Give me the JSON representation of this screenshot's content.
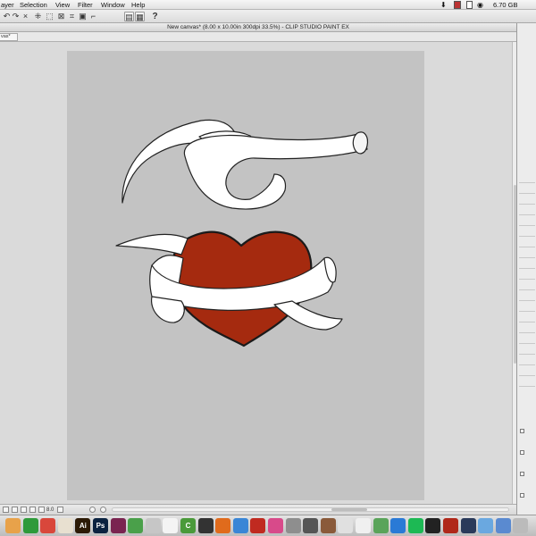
{
  "menubar": {
    "items": [
      "ayer",
      "Selection",
      "View",
      "Filter",
      "Window",
      "Help"
    ],
    "storage": "6.70 GB"
  },
  "toolbar": {
    "icons": [
      "undo-icon",
      "redo-icon",
      "clear-icon",
      "transform-icon",
      "select-all-icon",
      "deselect-icon",
      "crop-icon",
      "fill-icon",
      "ruler-icon",
      "snap-icon",
      "grid-icon",
      "help-icon"
    ]
  },
  "window": {
    "title": "New canvas* (8.00 x 10.00in 300dpi 33.5%)  - CLIP STUDIO PAINT EX",
    "tab_label": "vas*"
  },
  "statusbar": {
    "zoom": "8.0"
  },
  "canvas": {
    "background_color": "#c3c3c3",
    "heart_color": "#a52a0f",
    "ribbon_color": "#ffffff"
  },
  "dock": {
    "apps": [
      {
        "name": "finder-icon",
        "label": "",
        "color": "#e8a24a"
      },
      {
        "name": "facetime-icon",
        "label": "",
        "color": "#2e9a3a"
      },
      {
        "name": "chrome-icon",
        "label": "",
        "color": "#d9473b"
      },
      {
        "name": "photos-icon",
        "label": "",
        "color": "#e8e0d0"
      },
      {
        "name": "illustrator-icon",
        "label": "Ai",
        "color": "#2c1a05"
      },
      {
        "name": "photoshop-icon",
        "label": "Ps",
        "color": "#0b2240"
      },
      {
        "name": "indesign-icon",
        "label": "",
        "color": "#7a2450"
      },
      {
        "name": "numbers-icon",
        "label": "",
        "color": "#4aa04a"
      },
      {
        "name": "preview-icon",
        "label": "",
        "color": "#c6c6c6"
      },
      {
        "name": "calendar-icon",
        "label": "",
        "color": "#f4f4f4"
      },
      {
        "name": "clip-studio-icon",
        "label": "C",
        "color": "#4a9a3a"
      },
      {
        "name": "mail-icon",
        "label": "",
        "color": "#333333"
      },
      {
        "name": "firefox-icon",
        "label": "",
        "color": "#e06b1c"
      },
      {
        "name": "safari-icon",
        "label": "",
        "color": "#3a86d6"
      },
      {
        "name": "acrobat-icon",
        "label": "",
        "color": "#c02a20"
      },
      {
        "name": "itunes-icon",
        "label": "",
        "color": "#d84a8a"
      },
      {
        "name": "system-preferences-icon",
        "label": "",
        "color": "#8e8e8e"
      },
      {
        "name": "utilities-icon",
        "label": "",
        "color": "#555555"
      },
      {
        "name": "dictionary-icon",
        "label": "",
        "color": "#8a5a3a"
      },
      {
        "name": "font-book-icon",
        "label": "",
        "color": "#e0e0e0"
      },
      {
        "name": "textedit-icon",
        "label": "",
        "color": "#f0f0f0"
      },
      {
        "name": "maps-icon",
        "label": "",
        "color": "#5aa45a"
      },
      {
        "name": "app-store-icon",
        "label": "",
        "color": "#2a7ad6"
      },
      {
        "name": "spotify-icon",
        "label": "",
        "color": "#1db954"
      },
      {
        "name": "terminal-icon",
        "label": "",
        "color": "#222222"
      },
      {
        "name": "pdf-icon",
        "label": "",
        "color": "#b0281a"
      },
      {
        "name": "steam-icon",
        "label": "",
        "color": "#2a3a5a"
      },
      {
        "name": "folder-icon",
        "label": "",
        "color": "#6aa8e0"
      },
      {
        "name": "downloads-icon",
        "label": "",
        "color": "#5a8ad0"
      },
      {
        "name": "trash-icon",
        "label": "",
        "color": "#bbbbbb"
      }
    ]
  }
}
